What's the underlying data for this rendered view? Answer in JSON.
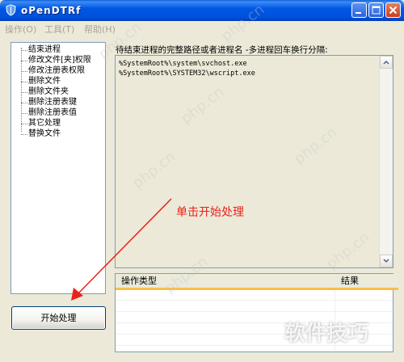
{
  "window": {
    "title": "oPenDTRf"
  },
  "menu": {
    "items": [
      "操作(O)",
      "工具(T)",
      "帮助(H)"
    ]
  },
  "tree": {
    "items": [
      "结束进程",
      "修改文件[夹]权限",
      "修改注册表权限",
      "删除文件",
      "删除文件夹",
      "删除注册表键",
      "删除注册表值",
      "其它处理",
      "替换文件"
    ]
  },
  "instruction": "待结束进程的完整路径或者进程名 -多进程回车换行分隔:",
  "processes": [
    "%SystemRoot%\\system\\svchost.exe",
    "%SystemRoot%\\SYSTEM32\\wscript.exe"
  ],
  "results": {
    "columns": [
      "操作类型",
      "结果"
    ],
    "rows": []
  },
  "start_button": "开始处理",
  "annotation": {
    "text": "单击开始处理",
    "color": "#E8231A"
  },
  "watermark": {
    "site": "php.cn",
    "corner": "软件技巧"
  },
  "colors": {
    "titlebar": "#0058E6",
    "header_underline": "#F7BE47",
    "window_bg": "#ECE9D8"
  }
}
